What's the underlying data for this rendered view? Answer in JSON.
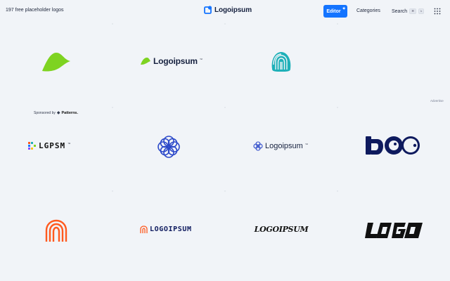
{
  "header": {
    "count_label": "197 free placeholder logos",
    "brand_name": "Logoipsum",
    "editor_label": "Editor",
    "categories_label": "Categories",
    "search_label": "Search",
    "search_keys": [
      "⌘",
      "k"
    ]
  },
  "colors": {
    "background": "#f1f4f8",
    "accent": "#1474ff",
    "green": "#7ed321",
    "teal": "#1eb0b8",
    "navy": "#0e1a5e",
    "blue": "#2b48c9",
    "orange": "#ff5a1f",
    "black": "#111111"
  },
  "sponsor": {
    "prefix": "Sponsored by",
    "name": "Patterns."
  },
  "advertise_label": "Advertise",
  "logos": [
    {
      "id": "green-wave",
      "icon": "green-wave-icon"
    },
    {
      "id": "green-logoipsum",
      "text": "Logoipsum",
      "icon": "green-leaf-icon"
    },
    {
      "id": "teal-fingerprint",
      "icon": "teal-fingerprint-icon"
    },
    {
      "id": "pixel-lgpsm",
      "text": "LGPSM",
      "icon": "pixel-blocks-icon"
    },
    {
      "id": "blue-knot",
      "icon": "blue-knot-icon"
    },
    {
      "id": "blue-logoipsum",
      "text": "Logoipsum",
      "icon": "blue-flower-icon"
    },
    {
      "id": "navy-lg-co",
      "icon": "navy-monogram-icon"
    },
    {
      "id": "orange-arch",
      "icon": "orange-arch-icon"
    },
    {
      "id": "orange-logoipsum",
      "text": "LOGOIPSUM",
      "icon": "orange-arch-small-icon"
    },
    {
      "id": "black-gothic",
      "text": "LOGOIPSUM",
      "icon": "gothic-wordmark-icon"
    },
    {
      "id": "black-logo",
      "text": "LOGO",
      "icon": "black-geometric-icon"
    }
  ]
}
